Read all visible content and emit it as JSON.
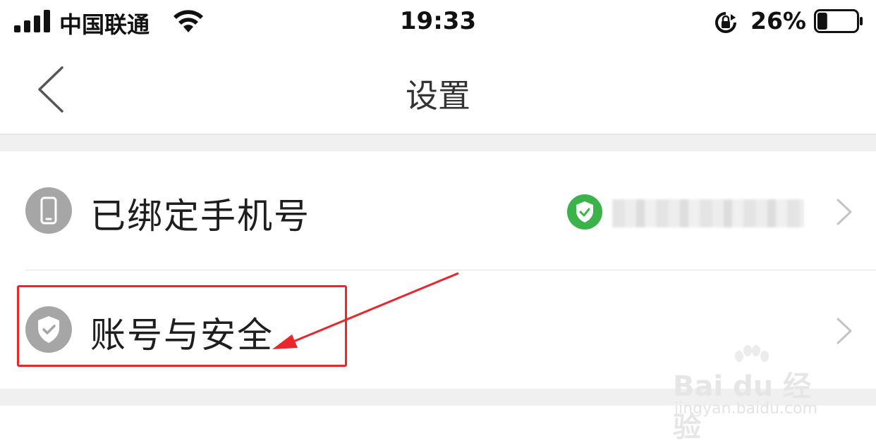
{
  "status_bar": {
    "carrier": "中国联通",
    "time": "19:33",
    "battery_percent": "26%",
    "battery_level": 0.26
  },
  "nav": {
    "title": "设置",
    "back_icon": "chevron-left-icon"
  },
  "rows": [
    {
      "label": "已绑定手机号",
      "icon": "phone-icon",
      "value_badge": "verified-shield-icon",
      "value": "",
      "chevron": "chevron-right-icon"
    },
    {
      "label": "账号与安全",
      "icon": "shield-check-icon",
      "chevron": "chevron-right-icon"
    }
  ],
  "annotation": {
    "box_color": "#e8262b",
    "arrow_color": "#e8262b"
  },
  "watermark": {
    "logo": "Bai du 经验",
    "url": "jingyan.baidu.com"
  },
  "colors": {
    "verified_green": "#3cb34a",
    "icon_gray": "#a6a6a6"
  }
}
